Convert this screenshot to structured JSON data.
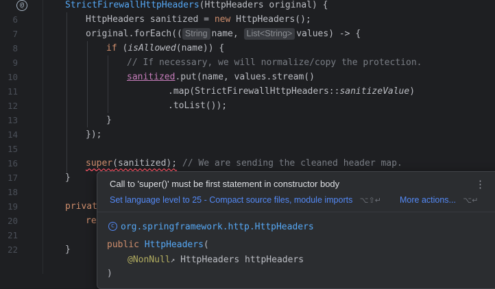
{
  "gutter": {
    "line_numbers": [
      "",
      "6",
      "7",
      "8",
      "9",
      "10",
      "11",
      "12",
      "13",
      "14",
      "15",
      "16",
      "17",
      "18",
      "19",
      "20",
      "21",
      "22"
    ],
    "override_icon": "@"
  },
  "code": {
    "l5": {
      "a": "StrictFirewallHttpHeaders",
      "b": "(HttpHeaders original) {"
    },
    "l6": {
      "a": "HttpHeaders sanitized = ",
      "kw": "new",
      "b": " HttpHeaders();"
    },
    "l7": {
      "a": "original.forEach((",
      "hint1": "String",
      "b": "name, ",
      "hint2": "List<String>",
      "c": "values) -> {"
    },
    "l8": {
      "kw": "if",
      "a": " (",
      "fn": "isAllowed",
      "b": "(name)) {"
    },
    "l9": {
      "comment": "// If necessary, we will normalize/copy the protection."
    },
    "l10": {
      "var": "sanitized",
      "a": ".put(name, values.stream()"
    },
    "l11": {
      "a": ".map(StrictFirewallHttpHeaders::",
      "it": "sanitizeValue",
      "b": ")"
    },
    "l12": {
      "a": ".toList());"
    },
    "l13": {
      "a": "}"
    },
    "l14": {
      "a": "});"
    },
    "l16": {
      "kw": "super",
      "a": "(sanitized);",
      "comment": " // We are sending the cleaned header map."
    },
    "l17": {
      "a": "}"
    },
    "l19": {
      "kw": "privat"
    },
    "l20": {
      "kw": "re"
    },
    "l22": {
      "a": "}"
    }
  },
  "popup": {
    "message": "Call to 'super()' must be first statement in constructor body",
    "menu_icon": "more-vertical-icon",
    "fix_label": "Set language level to 25 - Compact source files, module imports",
    "fix_shortcut": "⌥⇧↵",
    "more_label": "More actions...",
    "more_shortcut": "⌥↵",
    "class_icon": "class-icon",
    "class_fqn": "org.springframework.http.HttpHeaders",
    "sig_kw": "public",
    "sig_name": "HttpHeaders",
    "sig_open": "(",
    "param_ann": "@NonNull",
    "param_ann_arrow": "↗",
    "param_rest": " HttpHeaders httpHeaders",
    "sig_close": ")"
  },
  "colors": {
    "background": "#1e1f22",
    "keyword": "#cf8e6d",
    "function": "#56a8f5",
    "comment": "#7a7e85",
    "error": "#f75464",
    "link": "#548af7"
  }
}
